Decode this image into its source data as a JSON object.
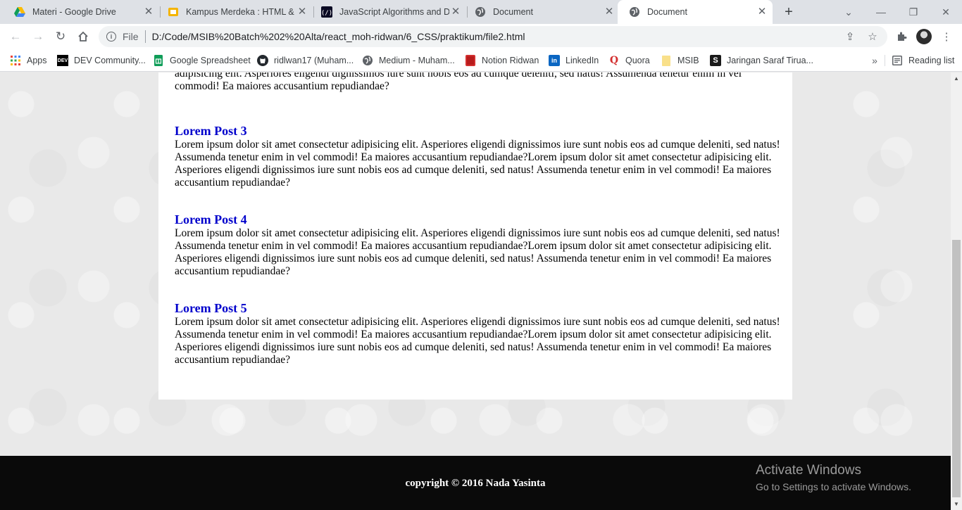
{
  "browser": {
    "tabs": [
      {
        "title": "Materi - Google Drive",
        "icon": "google-drive-icon",
        "active": false
      },
      {
        "title": "Kampus Merdeka : HTML & CSS",
        "icon": "kampus-merdeka-icon",
        "active": false
      },
      {
        "title": "JavaScript Algorithms and Data Structures",
        "icon": "freecodecamp-icon",
        "active": false
      },
      {
        "title": "Document",
        "icon": "globe-icon",
        "active": false
      },
      {
        "title": "Document",
        "icon": "globe-icon",
        "active": true
      }
    ],
    "address": {
      "scheme": "File",
      "url": "D:/Code/MSIB%20Batch%202%20Alta/react_moh-ridwan/6_CSS/praktikum/file2.html"
    },
    "bookmarks": [
      {
        "label": "Apps",
        "icon": "apps-grid-icon"
      },
      {
        "label": "DEV Community...",
        "icon": "dev-icon"
      },
      {
        "label": "Google Spreadsheet",
        "icon": "google-sheets-icon"
      },
      {
        "label": "ridlwan17 (Muham...",
        "icon": "github-icon"
      },
      {
        "label": "Medium - Muham...",
        "icon": "globe-icon"
      },
      {
        "label": "Notion Ridwan",
        "icon": "notion-icon"
      },
      {
        "label": "LinkedIn",
        "icon": "linkedin-icon"
      },
      {
        "label": "Quora",
        "icon": "quora-icon"
      },
      {
        "label": "MSIB",
        "icon": "folder-icon"
      },
      {
        "label": "Jaringan Saraf Tirua...",
        "icon": "scribd-icon"
      }
    ],
    "reading_list": "Reading list"
  },
  "page": {
    "partial_text": "adipisicing elit. Asperiores eligendi dignissimos iure sunt nobis eos ad cumque deleniti, sed natus! Assumenda tenetur enim in vel commodi! Ea maiores accusantium repudiandae?",
    "posts": [
      {
        "title": "Lorem Post 3",
        "body": "Lorem ipsum dolor sit amet consectetur adipisicing elit. Asperiores eligendi dignissimos iure sunt nobis eos ad cumque deleniti, sed natus! Assumenda tenetur enim in vel commodi! Ea maiores accusantium repudiandae?Lorem ipsum dolor sit amet consectetur adipisicing elit. Asperiores eligendi dignissimos iure sunt nobis eos ad cumque deleniti, sed natus! Assumenda tenetur enim in vel commodi! Ea maiores accusantium repudiandae?"
      },
      {
        "title": "Lorem Post 4",
        "body": "Lorem ipsum dolor sit amet consectetur adipisicing elit. Asperiores eligendi dignissimos iure sunt nobis eos ad cumque deleniti, sed natus! Assumenda tenetur enim in vel commodi! Ea maiores accusantium repudiandae?Lorem ipsum dolor sit amet consectetur adipisicing elit. Asperiores eligendi dignissimos iure sunt nobis eos ad cumque deleniti, sed natus! Assumenda tenetur enim in vel commodi! Ea maiores accusantium repudiandae?"
      },
      {
        "title": "Lorem Post 5",
        "body": "Lorem ipsum dolor sit amet consectetur adipisicing elit. Asperiores eligendi dignissimos iure sunt nobis eos ad cumque deleniti, sed natus! Assumenda tenetur enim in vel commodi! Ea maiores accusantium repudiandae?Lorem ipsum dolor sit amet consectetur adipisicing elit. Asperiores eligendi dignissimos iure sunt nobis eos ad cumque deleniti, sed natus! Assumenda tenetur enim in vel commodi! Ea maiores accusantium repudiandae?"
      }
    ],
    "footer": "copyright © 2016 Nada Yasinta",
    "post_title_color": "#0000cc",
    "footer_bg": "#0a0a0a"
  },
  "os_overlay": {
    "line1": "Activate Windows",
    "line2": "Go to Settings to activate Windows."
  }
}
